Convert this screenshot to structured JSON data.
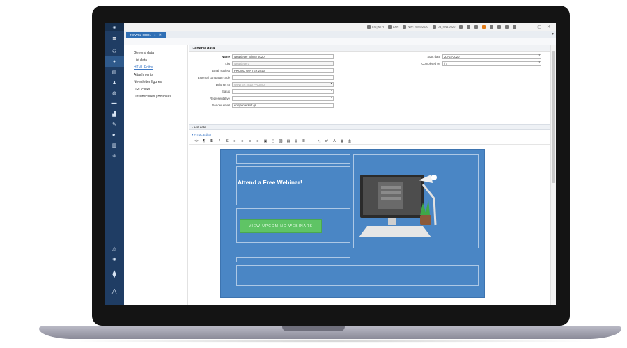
{
  "topbar": {
    "items": [
      "ES | NTH",
      "ANN",
      "Nov: 25/03/2020",
      "DB_SN5.2020"
    ],
    "window_controls": [
      "—",
      "▢",
      "✕"
    ]
  },
  "sidebar": {
    "menu_icon": "menu-icon",
    "icons": [
      "users-icon",
      "circle-icon",
      "book-icon",
      "person-icon",
      "box-icon",
      "truck-icon",
      "chart-icon",
      "edit-icon",
      "hand-icon",
      "bar-chart-icon",
      "settings-circle-icon"
    ],
    "bottom_icons": [
      "warning-icon",
      "gear-icon",
      "pin-icon",
      "robot-icon"
    ]
  },
  "tab": {
    "label": "NEWSL-00001",
    "pin": "●",
    "close": "✕"
  },
  "nav": {
    "items": [
      {
        "label": "General data",
        "link": false
      },
      {
        "label": "List data",
        "link": false
      },
      {
        "label": "HTML Editor",
        "link": true
      },
      {
        "label": "Attachments",
        "link": false
      },
      {
        "label": "Newsletter figures",
        "link": false
      },
      {
        "label": "URL clicks",
        "link": false
      },
      {
        "label": "Unsubscribes | Bounces",
        "link": false
      }
    ]
  },
  "general": {
    "header": "General data",
    "fields": [
      {
        "label": "Name",
        "value": "Newsletter Winter 2020",
        "dim": false,
        "select": false,
        "bold": true
      },
      {
        "label": "List",
        "value": "Newsletter1",
        "dim": true,
        "select": false,
        "bold": false
      },
      {
        "label": "Email subject",
        "value": "PROMO WINTER 2020",
        "dim": false,
        "select": false,
        "bold": false
      },
      {
        "label": "External campaign code",
        "value": "",
        "dim": false,
        "select": false,
        "bold": false
      },
      {
        "label": "Belongs to",
        "value": "WINTER 2020 PROMO",
        "dim": true,
        "select": true,
        "bold": false
      },
      {
        "label": "Status",
        "value": "",
        "dim": false,
        "select": true,
        "bold": false
      },
      {
        "label": "Representative",
        "value": "",
        "dim": false,
        "select": true,
        "bold": false
      },
      {
        "label": "Sender email",
        "value": "ent@entersoft.gr",
        "dim": false,
        "select": false,
        "bold": false
      }
    ],
    "start_date_label": "Start date",
    "start_date_value": "23-03-2020",
    "completed_label": "Completed on",
    "completed_value": "/ /"
  },
  "list_data_label": "▸ List data",
  "html_editor_label": "▾ HTML Editor",
  "toolbar": {
    "tools": [
      "<>",
      "¶",
      "B",
      "I",
      "S",
      "≡",
      "≡",
      "≡",
      "≡",
      "▣",
      "▢",
      "⛓",
      "▤",
      "▤",
      "≣",
      "—",
      "×₂",
      "x²",
      "A",
      "▦",
      "⎙"
    ]
  },
  "email": {
    "headline": "Attend a Free Webinar!",
    "button": "VIEW UPCOMING WEBINARS",
    "bg_color": "#4a86c5",
    "button_color": "#5fc465"
  },
  "colors": {
    "sidebar": "#1f3d64",
    "tab": "#2f6fb5",
    "link": "#3c78c6"
  }
}
